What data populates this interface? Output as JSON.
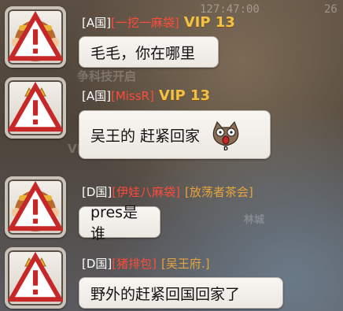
{
  "background": {
    "time_text": "127:47:00",
    "corner_text": "26",
    "shadow_texts": [
      "争科技开启",
      "VIP1开启",
      "林城"
    ]
  },
  "messages": [
    {
      "avatar_icon": "monkey-king-avatar",
      "region": "[A国]",
      "guild": "[一挖一麻袋]",
      "title": "",
      "vip": "VIP 13",
      "text": "毛毛，你在哪里",
      "sticker": ""
    },
    {
      "avatar_icon": "crowned-girl-avatar",
      "region": "[A国]",
      "guild": "[MissR]",
      "title": "",
      "vip": "VIP 13",
      "text": "吴王的 赶紧回家",
      "sticker": "shocked-owl-sticker",
      "sticker_letter": "D"
    },
    {
      "avatar_icon": "monkey-king-avatar",
      "region": "[D国]",
      "guild": "[伊娃八麻袋]",
      "title": "[放荡者茶会]",
      "vip": "",
      "text": "pres是谁",
      "sticker": ""
    },
    {
      "avatar_icon": "crowned-girl-avatar",
      "region": "[D国]",
      "guild": "[猪排包]",
      "title": "[吴王府.]",
      "vip": "",
      "text": "野外的赶紧回国回家了",
      "sticker": ""
    }
  ]
}
